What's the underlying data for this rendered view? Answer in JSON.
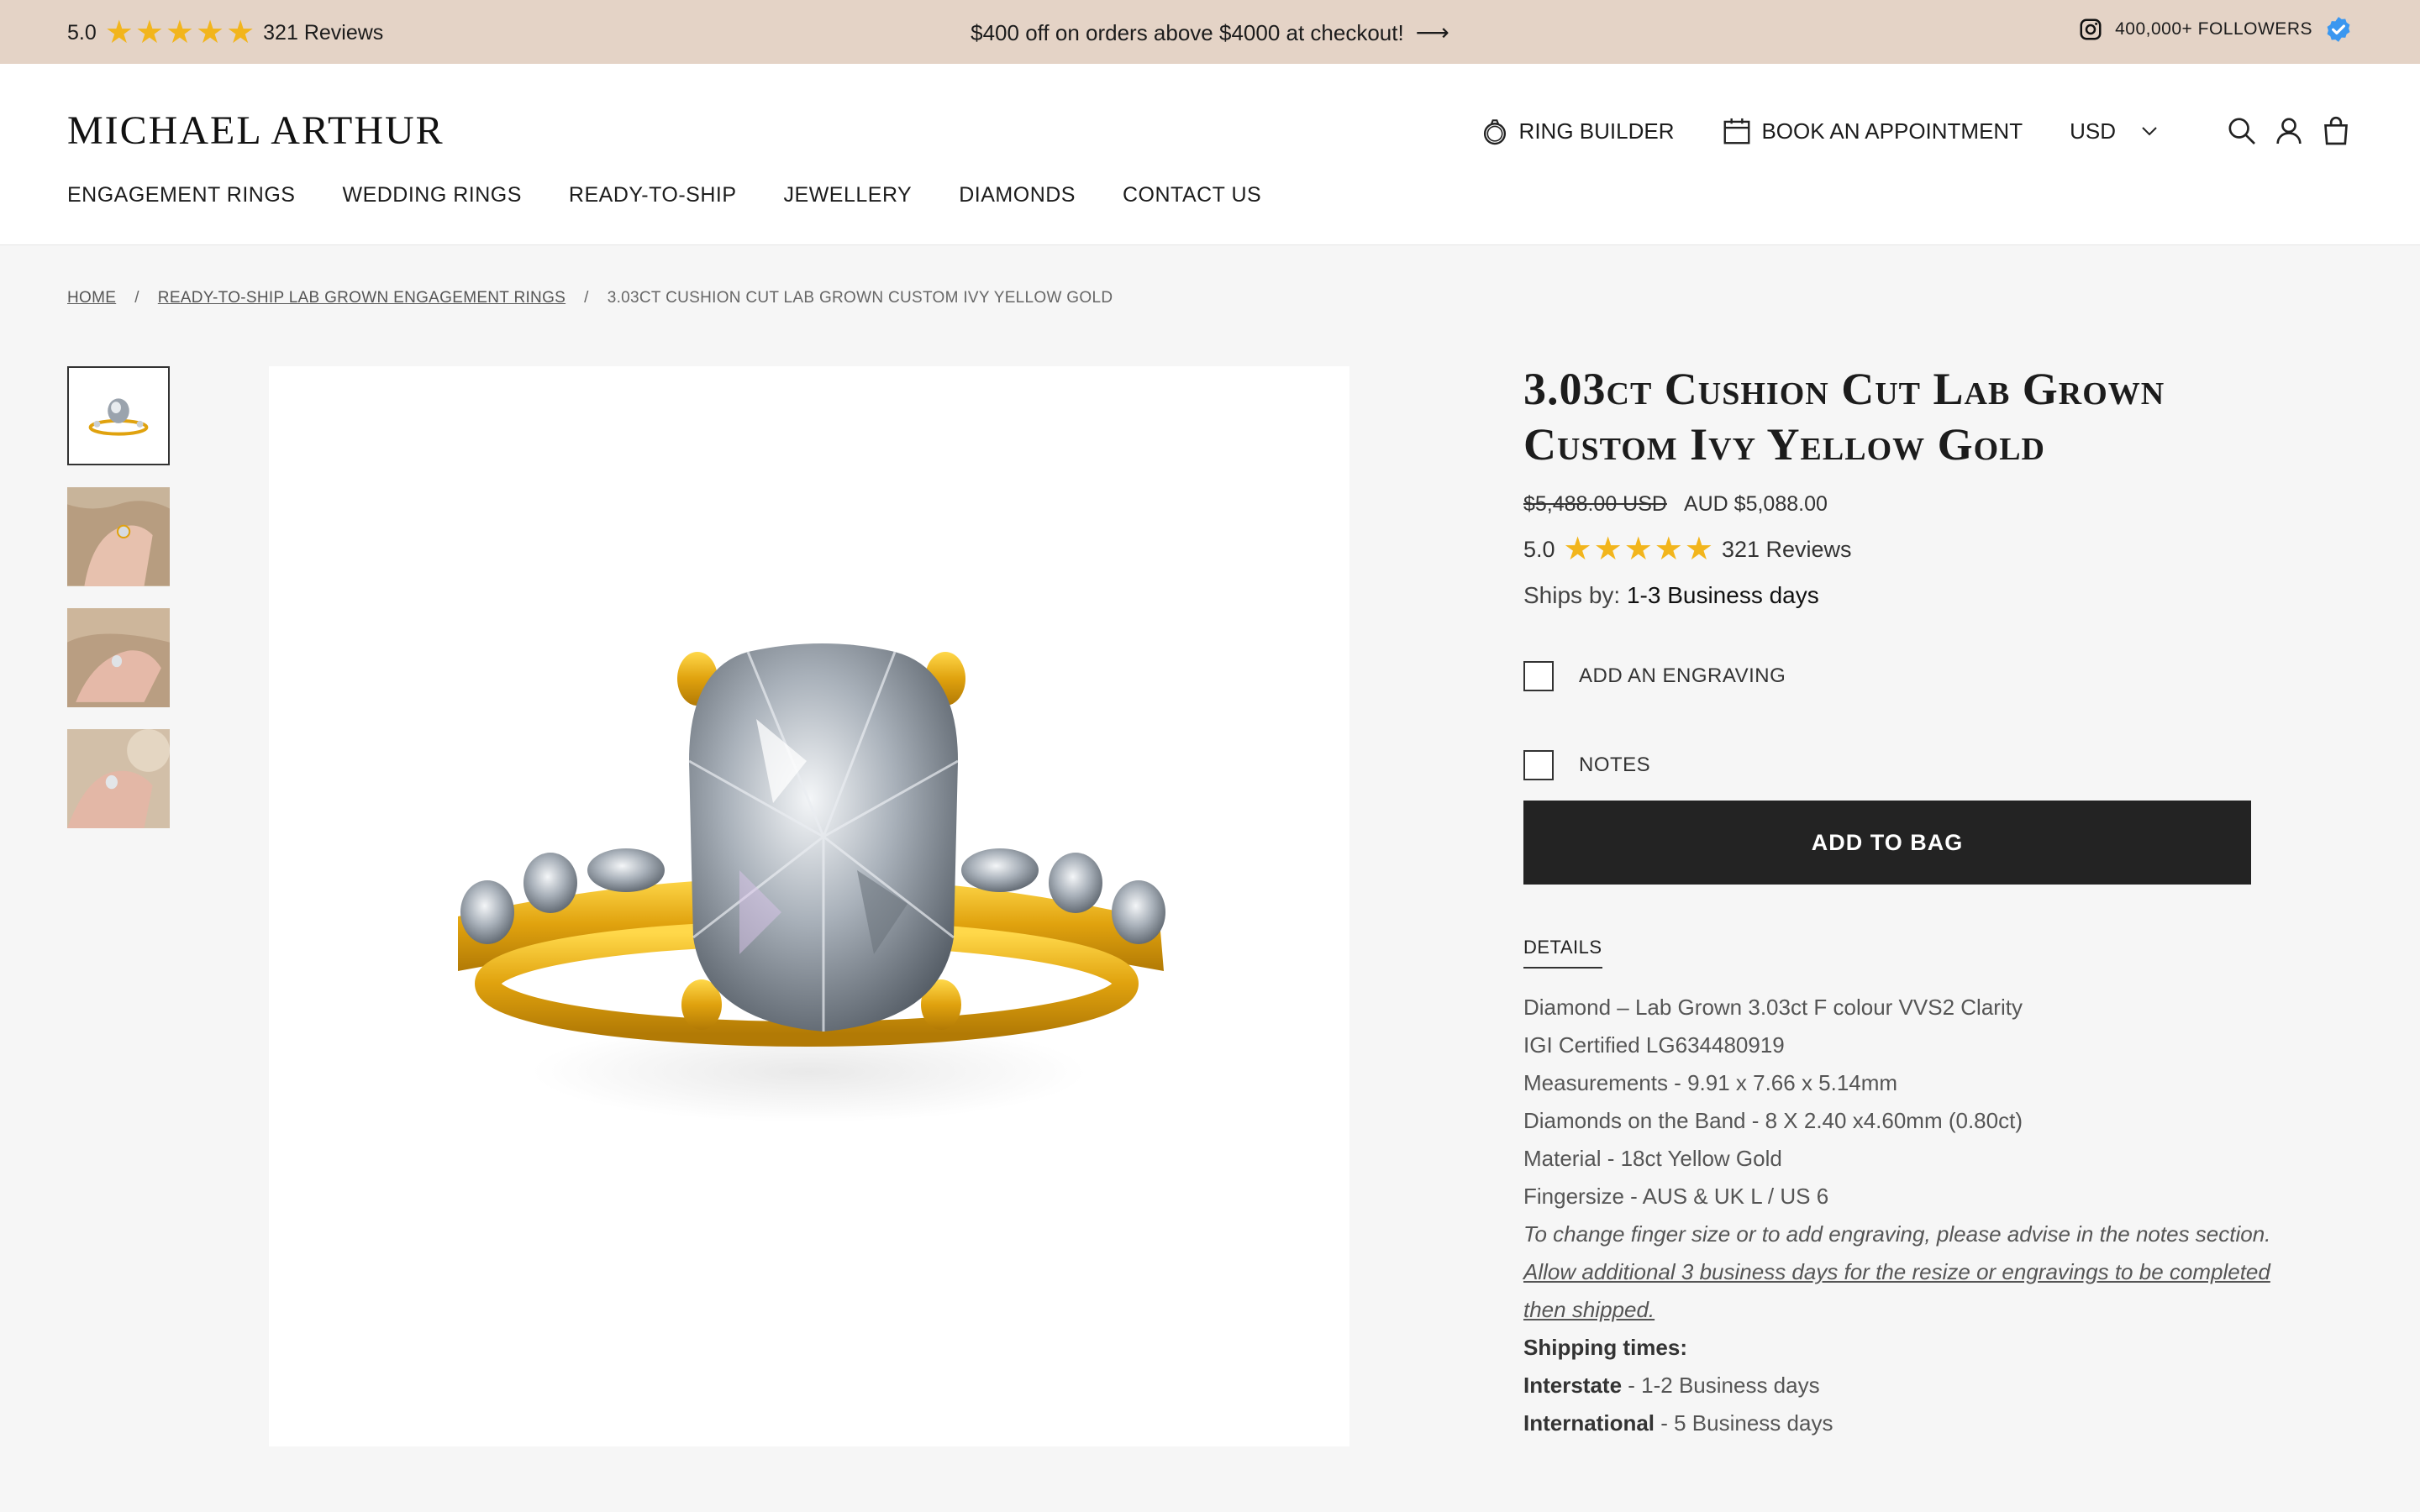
{
  "topbar": {
    "rating": "5.0",
    "reviews": "321 Reviews",
    "promo": "$400 off on orders above $4000 at checkout!",
    "followers": "400,000+ FOLLOWERS"
  },
  "header": {
    "logo": "MICHAEL ARTHUR",
    "ring_builder": "RING BUILDER",
    "book": "BOOK AN APPOINTMENT",
    "currency": "USD",
    "nav": [
      "ENGAGEMENT RINGS",
      "WEDDING RINGS",
      "READY-TO-SHIP",
      "JEWELLERY",
      "DIAMONDS",
      "CONTACT US"
    ]
  },
  "breadcrumb": {
    "home": "HOME",
    "category": "READY-TO-SHIP LAB GROWN ENGAGEMENT RINGS",
    "current": "3.03CT CUSHION CUT LAB GROWN CUSTOM IVY YELLOW GOLD",
    "separator": "/"
  },
  "product": {
    "title_line1": "3.03ct Cushion Cut Lab Grown",
    "title_line2": "Custom Ivy Yellow Gold",
    "old_price": "$5,488.00 USD",
    "price": "AUD $5,088.00",
    "rating": "5.0",
    "reviews": "321 Reviews",
    "ships_label": "Ships by:",
    "ships_value": "1-3 Business days",
    "engraving": "ADD AN ENGRAVING",
    "notes": "NOTES",
    "add_to_bag": "ADD TO BAG",
    "details_tab": "DETAILS",
    "details": [
      "Diamond – Lab Grown 3.03ct F colour VVS2 Clarity",
      "IGI Certified LG634480919",
      "Measurements - 9.91 x 7.66 x 5.14mm",
      "Diamonds on the Band - 8 X 2.40 x4.60mm (0.80ct)",
      "Material - 18ct Yellow Gold",
      "Fingersize - AUS & UK L / US 6"
    ],
    "note_italic": "To change finger size or to add engraving, please advise in the notes section.",
    "note_underline": "Allow additional 3 business days for the resize or engravings to be completed then shipped.",
    "shipping_heading": "Shipping times:",
    "interstate_label": "Interstate",
    "interstate_value": " - 1-2 Business days",
    "international_label": "International",
    "international_value": " - 5 Business days"
  },
  "colors": {
    "topbar": "#e4d3c6",
    "star": "#f2b51c",
    "button": "#232323",
    "gold": "#e0a20e"
  }
}
